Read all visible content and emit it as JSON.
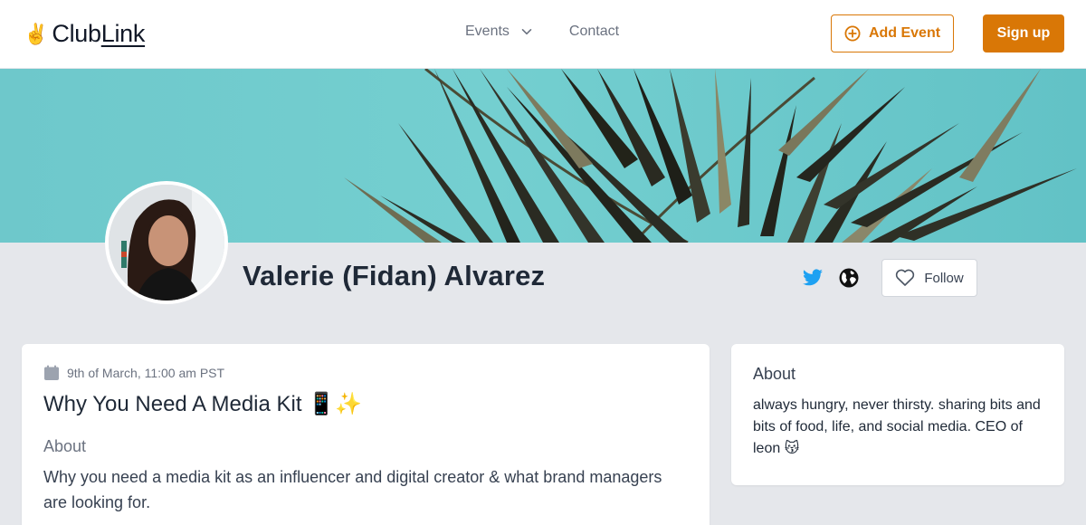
{
  "header": {
    "logo_emoji": "✌️",
    "logo_text_a": "Club",
    "logo_text_b": "Link",
    "nav": [
      {
        "label": "Events",
        "has_dropdown": true
      },
      {
        "label": "Contact",
        "has_dropdown": false
      }
    ],
    "add_event_label": "Add Event",
    "sign_up_label": "Sign up"
  },
  "profile": {
    "name": "Valerie (Fidan) Alvarez",
    "follow_label": "Follow",
    "social_icons": [
      "twitter-icon",
      "globe-icon"
    ]
  },
  "event": {
    "date": "9th of March, 11:00 am PST",
    "title": "Why You Need A Media Kit 📱✨",
    "about_heading": "About",
    "description": "Why you need a media kit as an influencer and digital creator & what brand managers are looking for."
  },
  "about": {
    "heading": "About",
    "text": "always hungry, never thirsty. sharing bits and bits of food, life, and social media. CEO of leon 😽"
  },
  "colors": {
    "accent": "#d97706",
    "twitter": "#1da1f2",
    "page_bg": "#e5e7eb",
    "banner_teal": "#6ec8cb"
  }
}
